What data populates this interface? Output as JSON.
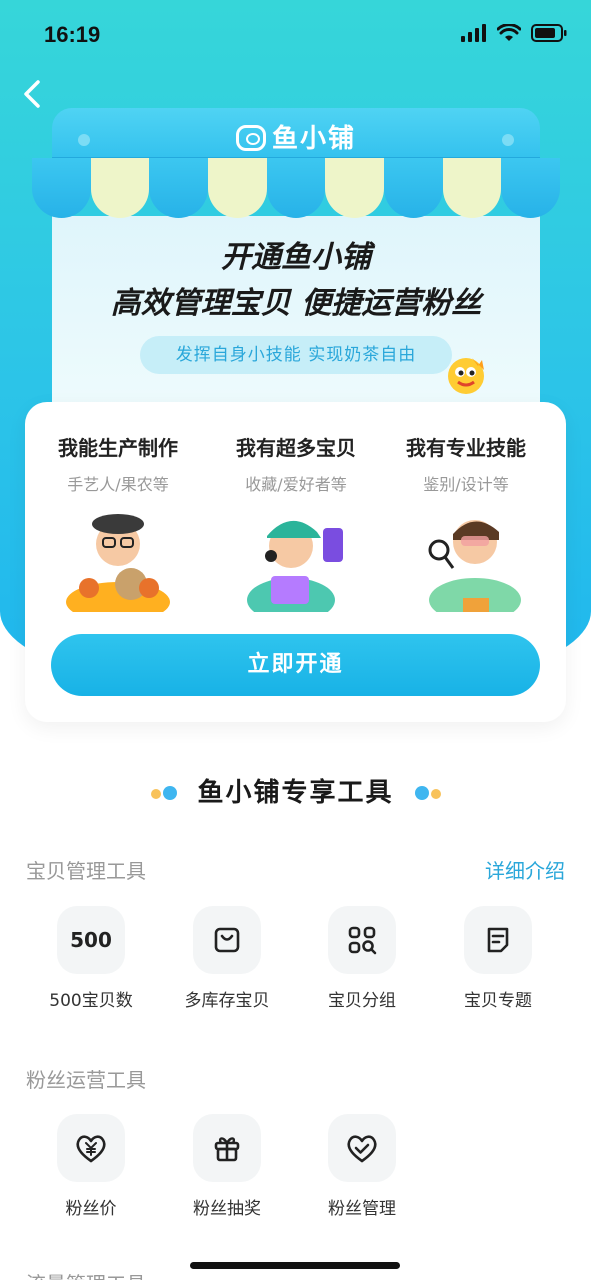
{
  "status_bar": {
    "time": "16:19"
  },
  "shop": {
    "logo_text": "鱼小铺",
    "headline_1": "开通鱼小铺",
    "headline_2": "高效管理宝贝 便捷运营粉丝",
    "slogan": "发挥自身小技能  实现奶茶自由"
  },
  "card": {
    "columns": [
      {
        "title": "我能生产制作",
        "subtitle": "手艺人/果农等"
      },
      {
        "title": "我有超多宝贝",
        "subtitle": "收藏/爱好者等"
      },
      {
        "title": "我有专业技能",
        "subtitle": "鉴别/设计等"
      }
    ],
    "open_button": "立即开通"
  },
  "tools": {
    "section_title": "鱼小铺专享工具",
    "detail_link": "详细介绍",
    "groups": [
      {
        "label": "宝贝管理工具",
        "items": [
          {
            "icon_text": "500",
            "label": "500宝贝数",
            "icon": "number-500-icon"
          },
          {
            "label": "多库存宝贝",
            "icon": "bag-icon"
          },
          {
            "label": "宝贝分组",
            "icon": "grid-search-icon"
          },
          {
            "label": "宝贝专题",
            "icon": "document-icon"
          }
        ]
      },
      {
        "label": "粉丝运营工具",
        "items": [
          {
            "label": "粉丝价",
            "icon": "heart-yen-icon"
          },
          {
            "label": "粉丝抽奖",
            "icon": "gift-icon"
          },
          {
            "label": "粉丝管理",
            "icon": "heart-check-icon"
          }
        ]
      },
      {
        "label": "流量管理工具"
      }
    ]
  },
  "colors": {
    "accent": "#2aa7da",
    "hero_top": "#36d6d9",
    "hero_bottom": "#1fb6ee"
  }
}
